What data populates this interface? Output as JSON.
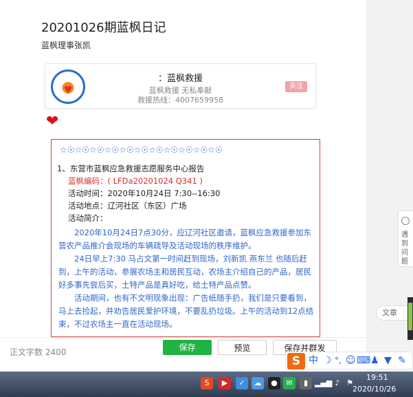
{
  "document": {
    "title": "20201026期蓝枫日记",
    "author": "蓝枫理事张凯"
  },
  "account_card": {
    "name": "：蓝枫救援",
    "description": "蓝枫救援  无私奉献",
    "hotline": "救援热线：4007659958",
    "follow_label": "关注"
  },
  "content": {
    "stars": "☆☉☆☉☆☉☆☉☆☉☆☉☆☉☆☉☆☉☆☉☆☉",
    "heading": "1、东营市蓝枫应急救援志愿服务中心报告",
    "code_line": "蓝枫编码：( LFDa20201024  Q341 )",
    "time_line": "活动时间：2020年10月24日 7:30--16:30",
    "place_line": "活动地点：辽河社区（东区）广场",
    "intro_label": "活动简介：",
    "para1": "2020年10月24日7点30分，应辽河社区邀请，蓝枫应急救援参加东营农产品推介会现场的车辆疏导及活动现场的秩序维护。",
    "para2": "24日早上7:30 马占文第一时间赶到现场，刘新凯  燕东兰 也随后赶到，上午的活动，参展农场主和居民互动，农场主介绍自己的产品，居民好多事先尝后买，土特产品是真好吃，给土特产品点赞。",
    "para3": "活动期间，也有不文明现象出现：广告纸随手扔，我们是只要看到，马上去捡起，并劝告居民爱护环境，不要乱扔垃圾。上午的活动到12点结束，不过农场主一直在活动现场。"
  },
  "toolbar": {
    "word_count": "正文字数  2400",
    "save_label": "保存",
    "preview_label": "预览",
    "save_send_label": "保存并群发"
  },
  "sidebar_tools": {
    "tool_label": "遇到问题",
    "article_label": "文章"
  },
  "ime": {
    "logo": "S",
    "mode": "中"
  },
  "taskbar": {
    "time": "19:51",
    "date": "2020/10/26"
  },
  "colors": {
    "accent_green": "#1fb341",
    "content_border": "#d84040",
    "link_blue": "#2f66c9",
    "code_red": "#d9302a"
  }
}
